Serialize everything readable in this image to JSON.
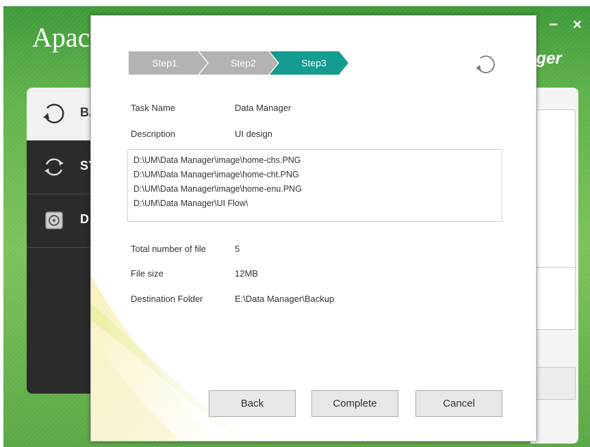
{
  "app": {
    "logo_text": "Apac",
    "title_partial": "ager",
    "minimize": "−",
    "close": "×",
    "sidebar": [
      {
        "label": "BA",
        "icon": "backup-icon"
      },
      {
        "label": "SY",
        "icon": "sync-icon"
      },
      {
        "label": "D",
        "icon": "disk-icon"
      }
    ]
  },
  "dialog": {
    "steps": [
      "Step1",
      "Step2",
      "Step3"
    ],
    "active_step": 3,
    "task_name_label": "Task Name",
    "task_name_value": "Data Manager",
    "description_label": "Description",
    "description_value": "UI design",
    "files": [
      "D:\\UM\\Data Manager\\image\\home-chs.PNG",
      "D:\\UM\\Data Manager\\image\\home-cht.PNG",
      "D:\\UM\\Data Manager\\image\\home-enu.PNG",
      "D:\\UM\\Data Manager\\UI Flow\\"
    ],
    "total_files_label": "Total number of file",
    "total_files_value": "5",
    "file_size_label": "File size",
    "file_size_value": "12MB",
    "destination_label": "Destination Folder",
    "destination_value": "E:\\Data Manager\\Backup",
    "buttons": {
      "back": "Back",
      "complete": "Complete",
      "cancel": "Cancel"
    }
  },
  "colors": {
    "active_step": "#139c8f",
    "inactive_step": "#b3b3b3",
    "app_green": "#5fb24a"
  }
}
